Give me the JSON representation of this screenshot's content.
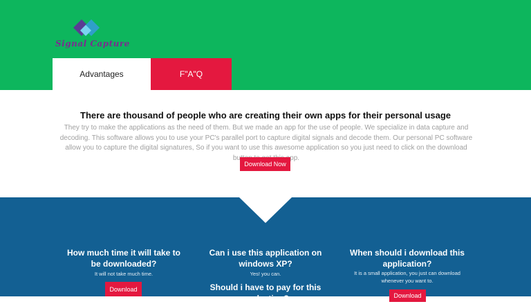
{
  "brand": {
    "logo_text": "Signal Capture"
  },
  "tabs": [
    {
      "label": "Advantages"
    },
    {
      "label": "F\"A\"Q"
    }
  ],
  "hero": {
    "title": "There are thousand of people who are creating their own apps for their personal usage",
    "text": "They try to make the applications as the need of them. But we made an app for the use of people. We specialize in data capture and decoding. This software allows you to use your PC's parallel port to capture digital signals and decode them. Our personal PC software allow you to capture the digital signatures, So if you want to use this awesome application so you just need to click on the download button to get this app.",
    "button": "Download Now"
  },
  "faq": [
    {
      "question": "How much time it will take to be downloaded?",
      "answer": "It will not take much time.",
      "button": "Download"
    },
    {
      "question": "Can i use this application on windows XP?",
      "answer": "Yes! you can."
    },
    {
      "question": "Should i have to pay for this applcation?"
    },
    {
      "question": "When should i download this application?",
      "answer": "It is a small application, you just can download whenever you want to.",
      "button": "Download"
    }
  ],
  "colors": {
    "header": "#0db65d",
    "accent": "#e4183f",
    "faq_bg": "#136093"
  },
  "icons": {
    "logo": "diamond-logo-icon"
  }
}
